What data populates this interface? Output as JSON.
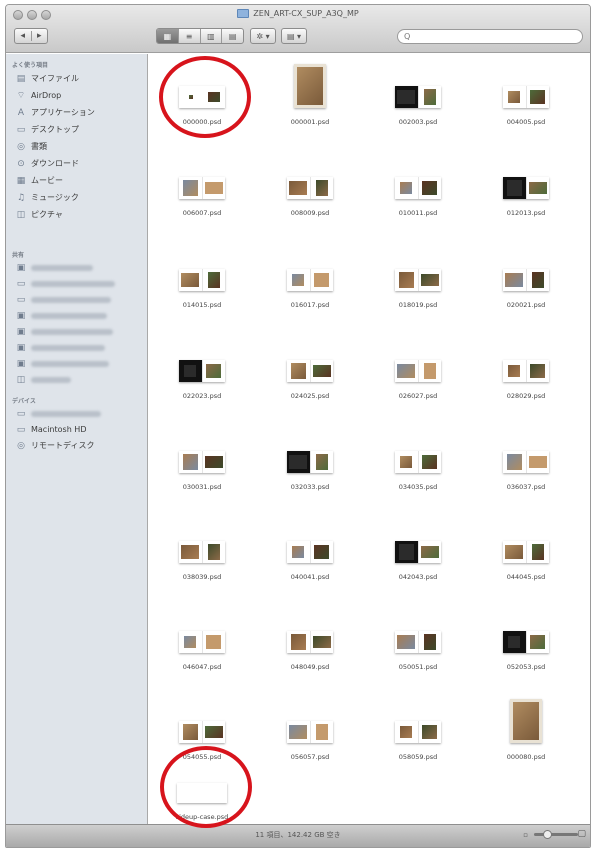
{
  "window": {
    "title": "ZEN_ART-CX_SUP_A3Q_MP",
    "status": "11 項目、142.42 GB 空き"
  },
  "toolbar": {
    "back": "◂",
    "forward": "▸",
    "views": [
      "▦",
      "≡",
      "▥",
      "▤"
    ],
    "action": "✲ ▾",
    "arrange": "▤ ▾",
    "search_placeholder": "Q"
  },
  "sidebar": {
    "favorites_header": "よく使う項目",
    "favorites": [
      {
        "icon": "document-icon",
        "glyph": "▤",
        "label": "マイファイル"
      },
      {
        "icon": "airdrop-icon",
        "glyph": "⌔",
        "label": "AirDrop"
      },
      {
        "icon": "applications-icon",
        "glyph": "A",
        "label": "アプリケーション"
      },
      {
        "icon": "desktop-icon",
        "glyph": "▭",
        "label": "デスクトップ"
      },
      {
        "icon": "documents-icon",
        "glyph": "◎",
        "label": "書類"
      },
      {
        "icon": "downloads-icon",
        "glyph": "⊙",
        "label": "ダウンロード"
      },
      {
        "icon": "movies-icon",
        "glyph": "▦",
        "label": "ムービー"
      },
      {
        "icon": "music-icon",
        "glyph": "♫",
        "label": "ミュージック"
      },
      {
        "icon": "pictures-icon",
        "glyph": "◫",
        "label": "ピクチャ"
      }
    ],
    "shared_header": "共有",
    "devices_header": "デバイス",
    "devices": [
      {
        "icon": "disk-icon",
        "glyph": "▭",
        "label": "Macintosh HD"
      },
      {
        "icon": "remote-disc-icon",
        "glyph": "◎",
        "label": "リモートディスク"
      }
    ]
  },
  "files": [
    {
      "name": "000000.psd",
      "type": "single-small"
    },
    {
      "name": "000001.psd",
      "type": "portrait"
    },
    {
      "name": "002003.psd",
      "type": "spread"
    },
    {
      "name": "004005.psd",
      "type": "spread"
    },
    {
      "name": "006007.psd",
      "type": "spread"
    },
    {
      "name": "008009.psd",
      "type": "spread"
    },
    {
      "name": "010011.psd",
      "type": "spread"
    },
    {
      "name": "012013.psd",
      "type": "spread"
    },
    {
      "name": "014015.psd",
      "type": "spread"
    },
    {
      "name": "016017.psd",
      "type": "spread"
    },
    {
      "name": "018019.psd",
      "type": "spread"
    },
    {
      "name": "020021.psd",
      "type": "spread"
    },
    {
      "name": "022023.psd",
      "type": "spread"
    },
    {
      "name": "024025.psd",
      "type": "spread"
    },
    {
      "name": "026027.psd",
      "type": "spread"
    },
    {
      "name": "028029.psd",
      "type": "spread"
    },
    {
      "name": "030031.psd",
      "type": "spread"
    },
    {
      "name": "032033.psd",
      "type": "spread"
    },
    {
      "name": "034035.psd",
      "type": "spread"
    },
    {
      "name": "036037.psd",
      "type": "spread"
    },
    {
      "name": "038039.psd",
      "type": "spread"
    },
    {
      "name": "040041.psd",
      "type": "spread"
    },
    {
      "name": "042043.psd",
      "type": "spread"
    },
    {
      "name": "044045.psd",
      "type": "spread"
    },
    {
      "name": "046047.psd",
      "type": "spread"
    },
    {
      "name": "048049.psd",
      "type": "spread"
    },
    {
      "name": "050051.psd",
      "type": "spread"
    },
    {
      "name": "052053.psd",
      "type": "spread"
    },
    {
      "name": "054055.psd",
      "type": "spread"
    },
    {
      "name": "056057.psd",
      "type": "spread"
    },
    {
      "name": "058059.psd",
      "type": "spread"
    },
    {
      "name": "000080.psd",
      "type": "portrait"
    },
    {
      "name": "sideup-case.psd",
      "type": "blank"
    }
  ],
  "colors": {
    "highlight": "#d7141c",
    "sidebar_bg": "#dfe4ea"
  }
}
